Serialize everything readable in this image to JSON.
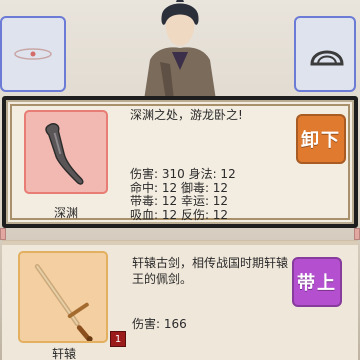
{
  "equipped": {
    "name": "深渊",
    "description": "深渊之处，游龙卧之!",
    "stats": "伤害: 310 身法: 12\n命中: 12 御毒: 12\n带毒: 12 幸运: 12\n吸血: 12 反伤: 12",
    "action_label": "卸下",
    "colors": {
      "frame": "#e77d74",
      "button": "#e07a2f"
    }
  },
  "bag_item": {
    "name": "轩辕",
    "description": "轩辕古剑，相传战国时期轩辕王的佩剑。",
    "stat": "伤害: 166",
    "count": "1",
    "action_label": "带上",
    "colors": {
      "frame": "#e3b061",
      "button": "#b44fd0"
    }
  },
  "slots": {
    "left_icon": "ring-icon",
    "right_icon": "helmet-icon"
  }
}
